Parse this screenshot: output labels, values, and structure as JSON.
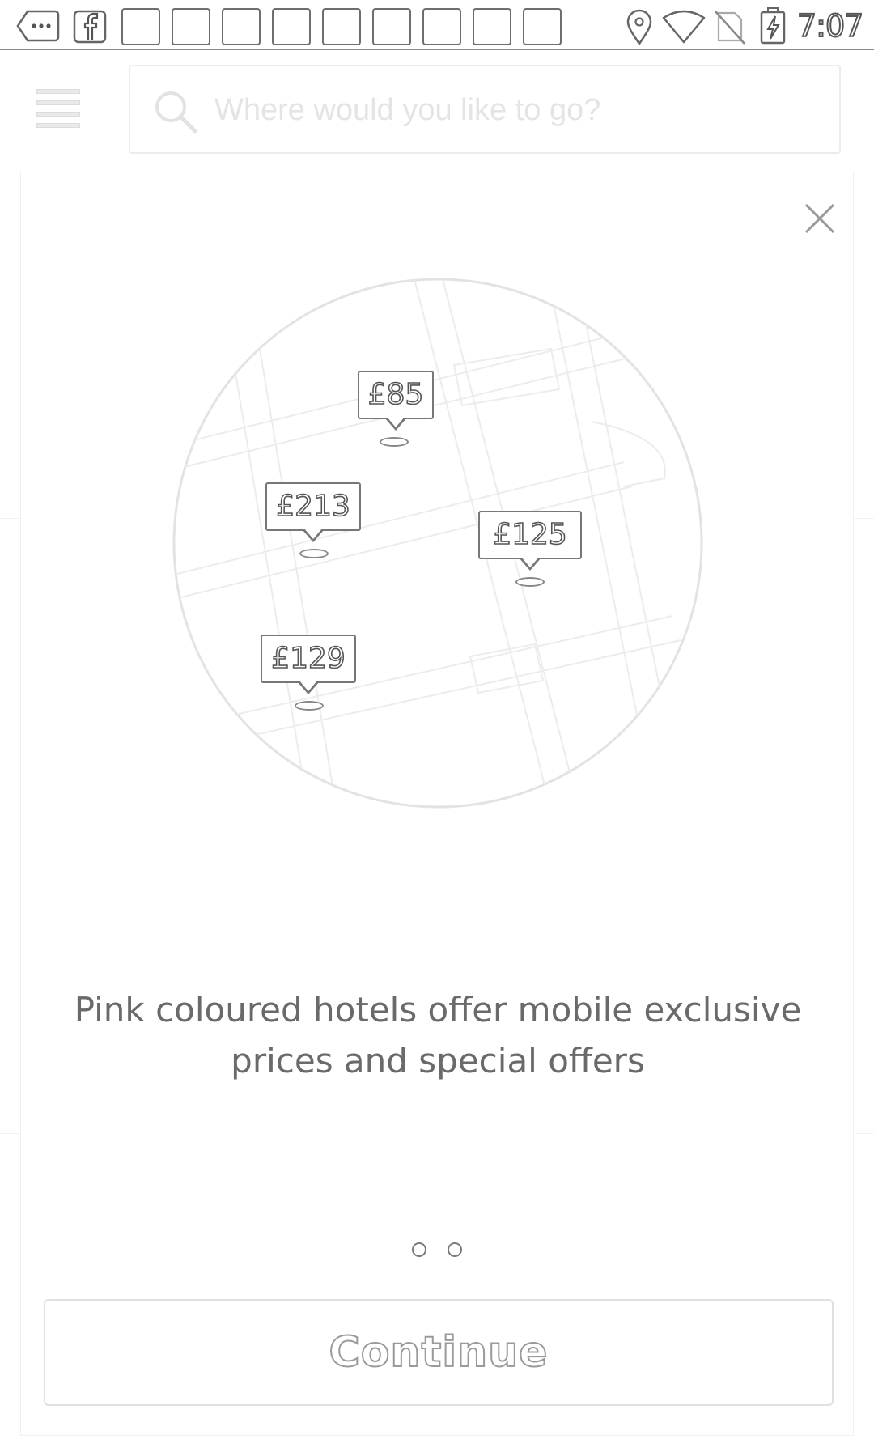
{
  "status_bar": {
    "time": "7:07",
    "icons": [
      "more-options-icon",
      "facebook-icon",
      "notification-placeholder",
      "location-icon",
      "wifi-icon",
      "no-sim-icon",
      "battery-charging-icon"
    ]
  },
  "header": {
    "menu_icon": "hamburger-menu-icon",
    "search": {
      "placeholder": "Where would you like to go?",
      "value": ""
    }
  },
  "onboarding": {
    "close_icon": "close-icon",
    "map_prices": [
      "£85",
      "£213",
      "£125",
      "£129"
    ],
    "description": "Pink coloured hotels offer mobile exclusive prices and special offers",
    "page_count": 2,
    "continue_label": "Continue"
  },
  "colors": {
    "outline": "#777777",
    "background": "#ffffff"
  }
}
